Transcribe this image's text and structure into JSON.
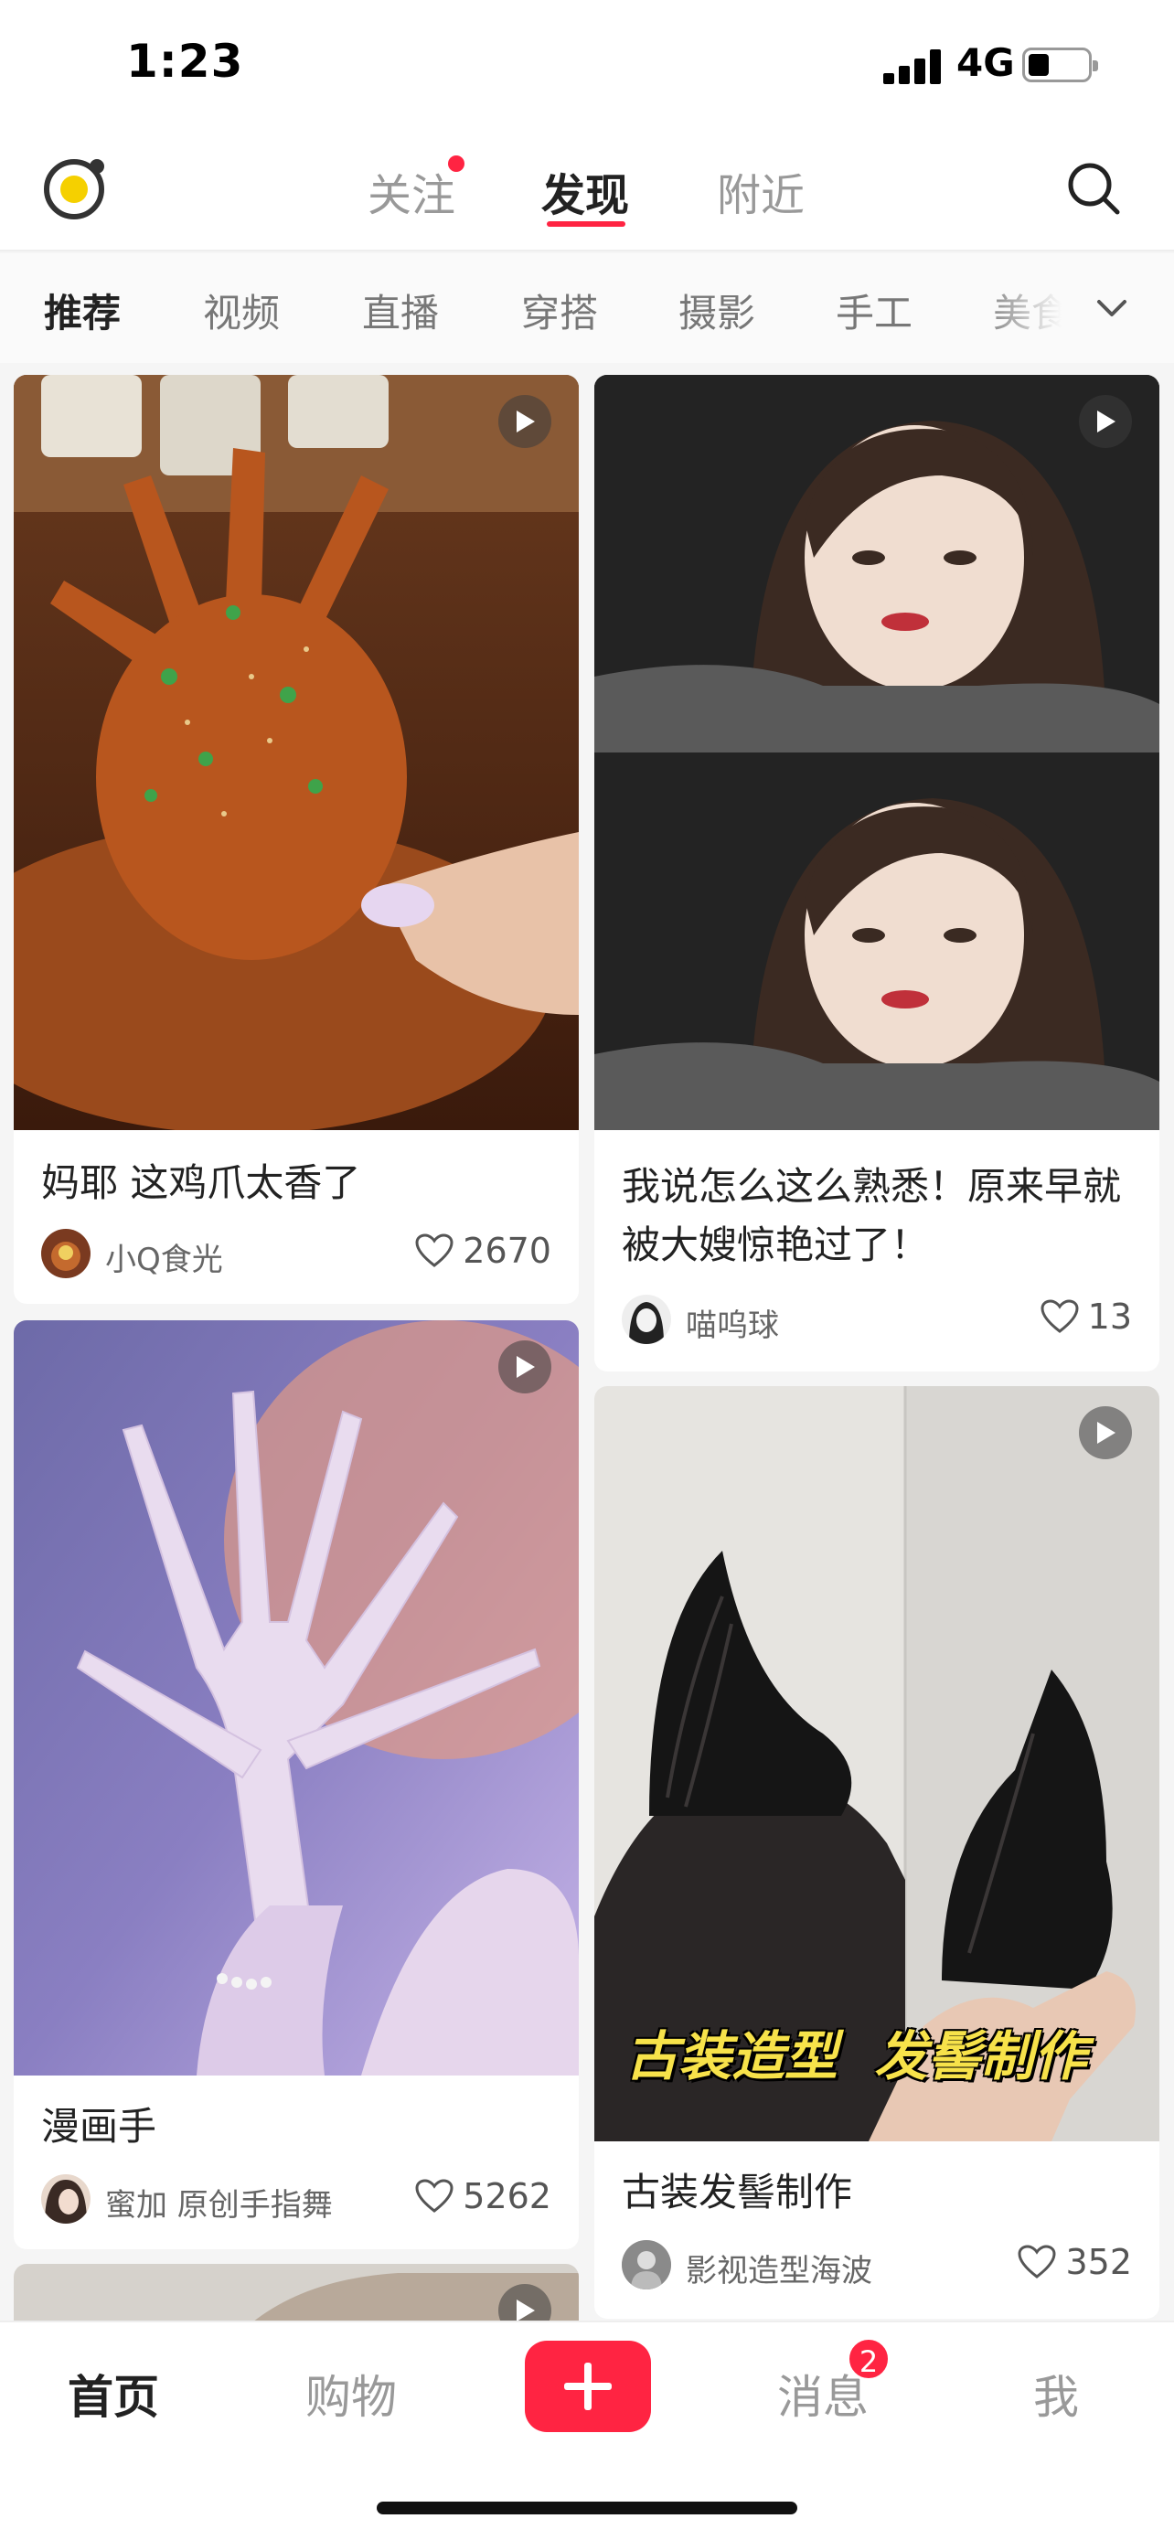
{
  "status_bar": {
    "time": "1:23",
    "network": "4G",
    "battery_level": 0.3
  },
  "top_nav": {
    "tabs": [
      {
        "label": "关注",
        "has_dot": true
      },
      {
        "label": "发现",
        "active": true
      },
      {
        "label": "附近"
      }
    ],
    "icons": {
      "logo": "camera-logo-icon",
      "search": "search-icon"
    }
  },
  "categories": {
    "items": [
      "推荐",
      "视频",
      "直播",
      "穿搭",
      "摄影",
      "手工",
      "美食"
    ],
    "active_index": 0,
    "more_icon": "chevron-down-icon"
  },
  "feed": {
    "cards": [
      {
        "title": "妈耶 这鸡爪太香了",
        "author": "小Q食光",
        "likes": "2670",
        "is_video": true
      },
      {
        "title": "我说怎么这么熟悉！原来早就\n被大嫂惊艳过了！",
        "author": "喵呜球",
        "likes": "13",
        "is_video": true
      },
      {
        "title": "漫画手",
        "author": "蜜加 原创手指舞",
        "likes": "5262",
        "is_video": true
      },
      {
        "title": "古装发髻制作",
        "author": "影视造型海波",
        "likes": "352",
        "is_video": true,
        "cover_text": "古装造型  发髻制作"
      }
    ]
  },
  "bottom_bar": {
    "tabs": [
      "首页",
      "购物",
      "消息",
      "我"
    ],
    "active": "首页",
    "messages_badge": "2",
    "plus_icon": "plus-icon"
  },
  "colors": {
    "accent": "#ff2442",
    "text": "#222222",
    "muted": "#999999"
  }
}
